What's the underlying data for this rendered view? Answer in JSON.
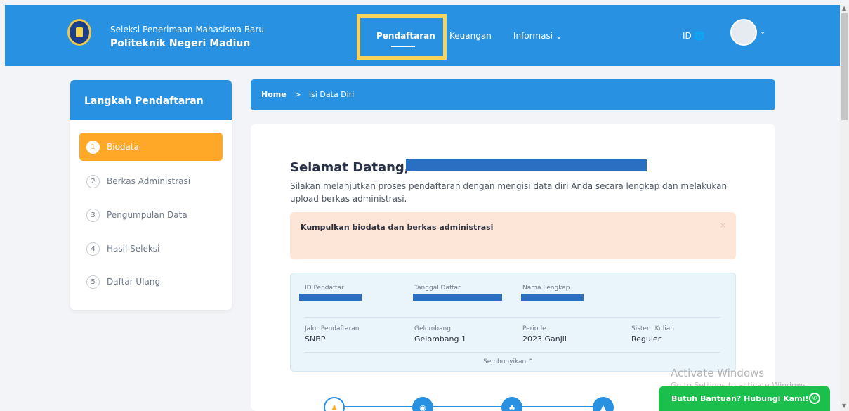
{
  "header": {
    "subtitle": "Seleksi Penerimaan Mahasiswa Baru",
    "title": "Politeknik Negeri Madiun",
    "nav": {
      "pendaftaran": "Pendaftaran",
      "keuangan": "Keuangan",
      "informasi": "Informasi ⌄"
    },
    "language": "ID 🌐",
    "avatar_caret": "⌄"
  },
  "sidebar": {
    "title": "Langkah Pendaftaran",
    "steps": [
      {
        "num": "1",
        "label": "Biodata",
        "active": true
      },
      {
        "num": "2",
        "label": "Berkas Administrasi",
        "active": false
      },
      {
        "num": "3",
        "label": "Pengumpulan Data",
        "active": false
      },
      {
        "num": "4",
        "label": "Hasil Seleksi",
        "active": false
      },
      {
        "num": "5",
        "label": "Daftar Ulang",
        "active": false
      }
    ]
  },
  "breadcrumb": {
    "home": "Home",
    "separator": ">",
    "current": "Isi Data Diri"
  },
  "main": {
    "welcome": "Selamat Datang,",
    "intro": "Silakan melanjutkan proses pendaftaran dengan mengisi data diri Anda secara lengkap dan melakukan upload berkas administrasi.",
    "alert": {
      "text": "Kumpulkan biodata dan berkas administrasi",
      "close": "×"
    },
    "info": {
      "id_label": "ID Pendaftar",
      "tanggal_label": "Tanggal Daftar",
      "nama_label": "Nama Lengkap",
      "jalur_label": "Jalur Pendaftaran",
      "jalur_value": "SNBP",
      "gelombang_label": "Gelombang",
      "gelombang_value": "Gelombang 1",
      "periode_label": "Periode",
      "periode_value": "2023 Ganjil",
      "sistem_label": "Sistem Kuliah",
      "sistem_value": "Reguler",
      "toggle": "Sembunyikan ⌃"
    },
    "progress_icons": [
      "user-icon",
      "map-pin-icon",
      "users-icon",
      "graduation-cap-icon",
      "check-icon"
    ]
  },
  "watermark": {
    "title": "Activate Windows",
    "subtitle": "Go to Settings to activate Windows."
  },
  "whatsapp": {
    "label": "Butuh Bantuan? Hubungi Kami!"
  },
  "colors": {
    "primary": "#2891e1",
    "accent": "#ffa726",
    "alert_bg": "#fde6d8",
    "info_bg": "#eaf4fb",
    "whatsapp": "#1bbf4b"
  }
}
